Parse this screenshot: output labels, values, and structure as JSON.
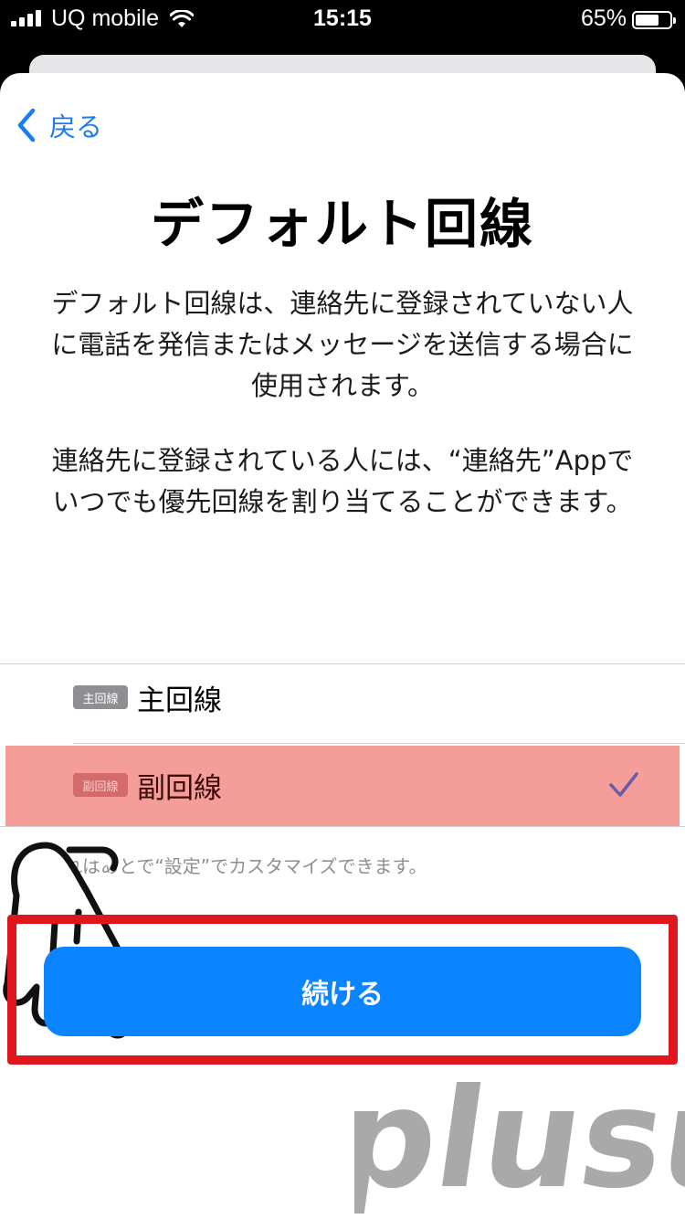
{
  "status_bar": {
    "carrier": "UQ mobile",
    "time": "15:15",
    "battery_percent": "65%",
    "battery_level": 0.65
  },
  "nav": {
    "back_label": "戻る"
  },
  "screen": {
    "title": "デフォルト回線",
    "description_1": "デフォルト回線は、連絡先に登録されていない人に電話を発信またはメッセージを送信する場合に使用されます。",
    "description_2": "連絡先に登録されている人には、“連絡先”Appでいつでも優先回線を割り当てることができます。"
  },
  "lines": [
    {
      "badge": "主回線",
      "label": "主回線",
      "selected": false
    },
    {
      "badge": "副回線",
      "label": "副回線",
      "selected": true
    }
  ],
  "footnote": "これはあとで“設定”でカスタマイズできます。",
  "continue_label": "続ける",
  "watermark": "plusul",
  "colors": {
    "accent": "#0a84ff",
    "highlight": "#f09a97",
    "frame": "#e0161d"
  }
}
